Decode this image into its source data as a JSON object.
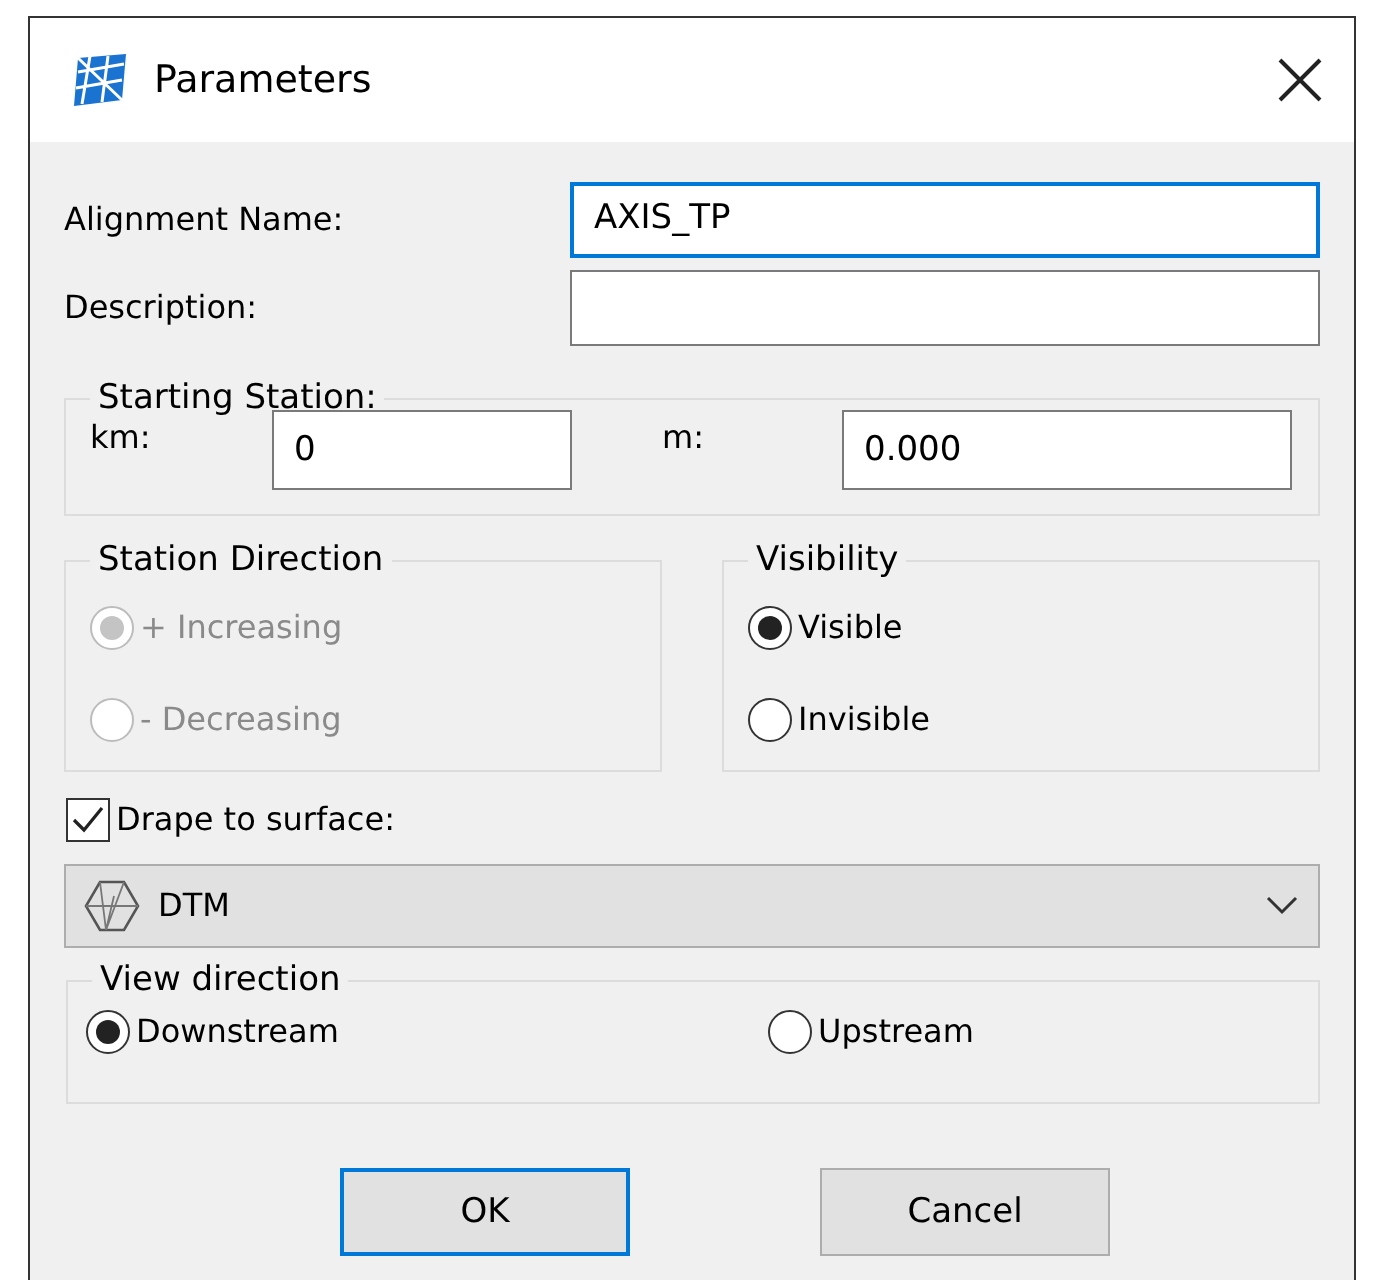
{
  "window": {
    "title": "Parameters"
  },
  "fields": [
    {
      "label": "Alignment Name:",
      "value": "AXIS_TP",
      "focused": true
    },
    {
      "label": "Description:",
      "focused": false
    }
  ],
  "starting_station": {
    "title": "Starting Station:",
    "inputs": [
      {
        "label": "km:",
        "value": "0"
      },
      {
        "label": "m:",
        "value": "0.000"
      }
    ]
  },
  "station_direction": {
    "title": "Station Direction",
    "disabled": true,
    "options": [
      {
        "label": "+ Increasing",
        "selected": true
      },
      {
        "label": "- Decreasing",
        "selected": false
      }
    ]
  },
  "visibility": {
    "title": "Visibility",
    "options": [
      {
        "label": "Visible",
        "selected": true
      },
      {
        "label": "Invisible",
        "selected": false
      }
    ]
  },
  "drape": {
    "label": "Drape to surface:",
    "checked": true
  },
  "surface_dropdown": {
    "value": "DTM"
  },
  "view_direction": {
    "title": "View direction",
    "options": [
      {
        "label": "Downstream",
        "selected": true
      },
      {
        "label": "Upstream",
        "selected": false
      }
    ]
  },
  "buttons": [
    {
      "label": "OK",
      "default": true
    },
    {
      "label": "Cancel",
      "default": false
    }
  ]
}
